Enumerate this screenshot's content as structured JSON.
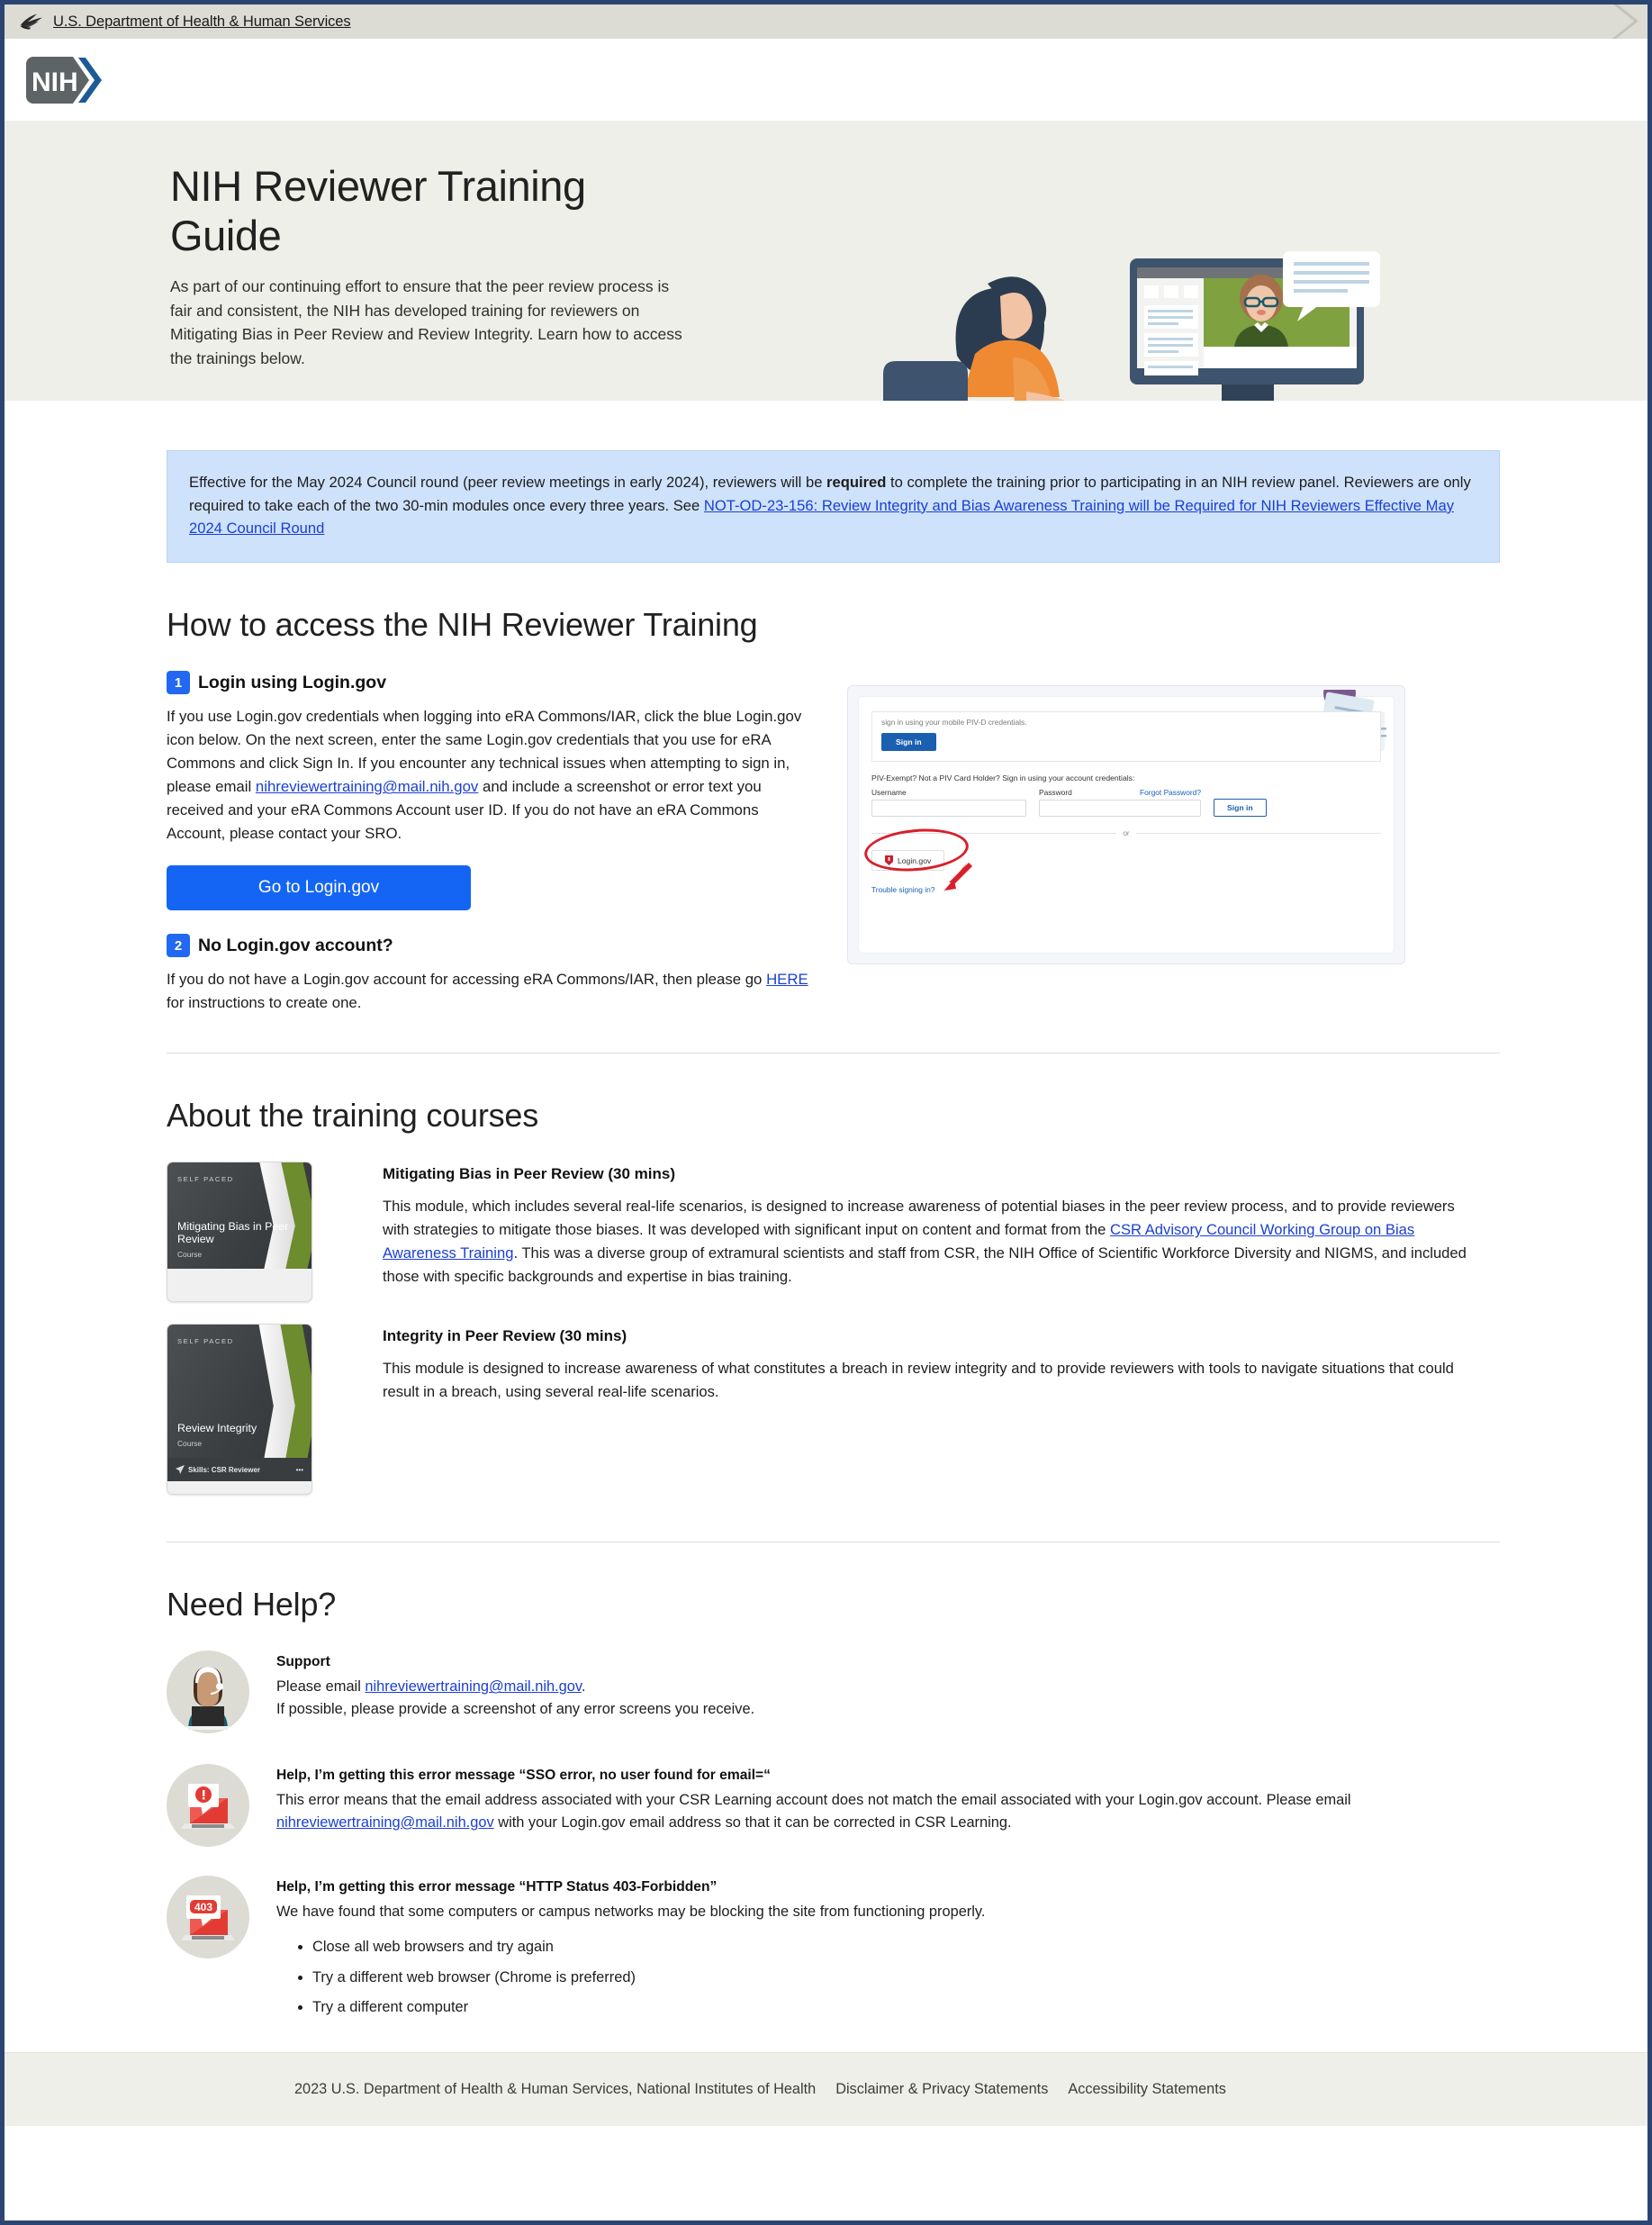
{
  "topbar": {
    "icon": "hhs-eagle-logo",
    "link_text": "U.S. Department of Health & Human Services"
  },
  "brand": {
    "logo_text": "NIH",
    "logo_alt": "nih-logo"
  },
  "hero": {
    "title": "NIH Reviewer Training Guide",
    "subtitle": "As part of our continuing effort to ensure that the peer review process is fair and consistent, the NIH has developed training for reviewers on Mitigating Bias in Peer Review and Review Integrity. Learn how to access the trainings below.",
    "illustration": "woman-at-computer-illustration"
  },
  "alert": {
    "text_1": "Effective for the May 2024 Council round (peer review meetings in early 2024), reviewers will be ",
    "bold": "required",
    "text_2": " to complete the training prior to participating in an NIH review panel. Reviewers are only required to take each of the two 30-min modules once every three years. See ",
    "link": "NOT-OD-23-156: Review Integrity and Bias Awareness Training will be Required for NIH Reviewers Effective May 2024 Council Round",
    "bg_color": "#cfe2fb"
  },
  "access": {
    "heading": "How to access the NIH Reviewer Training",
    "step1": {
      "number": "1",
      "title": "Login using Login.gov",
      "p_1": "If you use Login.gov credentials when logging into eRA Commons/IAR, click the blue Login.gov icon below. On the next screen, enter the same Login.gov credentials that you use for eRA Commons and click Sign In. If you encounter any technical issues when attempting to sign in, please email ",
      "email": "nihreviewertraining@mail.nih.gov",
      "p_2": " and include a screenshot or error text you received and your eRA Commons Account user ID. If you do not have an eRA Commons Account, please contact your SRO.",
      "button": "Go to Login.gov"
    },
    "step2": {
      "number": "2",
      "title": "No Login.gov account?",
      "p_1": "If you do not have a Login.gov account for accessing eRA Commons/IAR, then please go ",
      "link": "HERE",
      "p_2": " for instructions to create one."
    }
  },
  "login_screenshot": {
    "piv_text": "sign in using your mobile PIV-D credentials.",
    "piv_button": "Sign in",
    "exempt_text": "PIV-Exempt? Not a PIV Card Holder? Sign in using your account credentials:",
    "username_label": "Username",
    "password_label": "Password",
    "forgot_label": "Forgot Password?",
    "signin_button": "Sign in",
    "or_label": "or",
    "logingov_button": "Login.gov",
    "trouble_link": "Trouble signing in?",
    "annotation": "red-ellipse-and-arrow"
  },
  "courses": {
    "heading": "About the training courses",
    "items": [
      {
        "card": {
          "badge": "SELF PACED",
          "title": "Mitigating Bias in Peer Review",
          "subtitle": "Course",
          "footer_label": "",
          "show_footer": false
        },
        "title": "Mitigating Bias in Peer Review (30 mins)",
        "p_1": "This module, which includes several real-life scenarios, is designed to increase awareness of potential biases in the peer review process, and to provide reviewers with strategies to mitigate those biases. It was developed with significant input on content and format from the ",
        "link": "CSR Advisory Council Working Group on Bias Awareness Training",
        "p_2": ". This was a diverse group of extramural scientists and staff from CSR, the NIH Office of Scientific Workforce Diversity and NIGMS, and included those with specific backgrounds and expertise in bias training."
      },
      {
        "card": {
          "badge": "SELF PACED",
          "title": "Review Integrity",
          "subtitle": "Course",
          "footer_label": "Skills: CSR Reviewer",
          "show_footer": true
        },
        "title": "Integrity in Peer Review (30 mins)",
        "p_1": "This module is designed to increase awareness of what constitutes a breach in review integrity and to provide reviewers with tools to navigate situations that could result in a breach, using several real-life scenarios.",
        "link": "",
        "p_2": ""
      }
    ]
  },
  "help": {
    "heading": "Need Help?",
    "items": [
      {
        "icon": "support-agent-headset-avatar",
        "title": "Support",
        "p_1": "Please email ",
        "link": "nihreviewertraining@mail.nih.gov",
        "p_2": ".",
        "p_3": "If possible, please provide a screenshot of any error screens you receive.",
        "bullets": []
      },
      {
        "icon": "laptop-error-alert-icon",
        "title": "Help, I’m getting this error message “SSO error, no user found for email=“",
        "p_1": "This error means that the email address associated with your CSR Learning account does not match the email associated with your Login.gov account. Please email ",
        "link": "nihreviewertraining@mail.nih.gov",
        "p_2": " with your Login.gov email address so that it can be corrected in CSR Learning.",
        "p_3": "",
        "bullets": []
      },
      {
        "icon": "laptop-403-forbidden-icon",
        "title": "Help, I’m getting this error message “HTTP Status 403-Forbidden”",
        "p_1": "We have found that some computers or campus networks may be blocking the site from functioning properly.",
        "link": "",
        "p_2": "",
        "p_3": "",
        "bullets": [
          "Close all web browsers and try again",
          "Try a different web browser (Chrome is preferred)",
          "Try a different computer"
        ]
      }
    ]
  },
  "footer": {
    "copyright": "2023 U.S. Department of Health & Human Services, National Institutes of Health",
    "links": [
      "Disclaimer & Privacy Statements",
      "Accessibility Statements"
    ]
  },
  "colors": {
    "accent_blue": "#1565f5",
    "link_blue": "#1a3fd4",
    "hero_bg": "#efefe9",
    "alert_bg": "#cfe2fb",
    "window_border": "#2c4472"
  }
}
